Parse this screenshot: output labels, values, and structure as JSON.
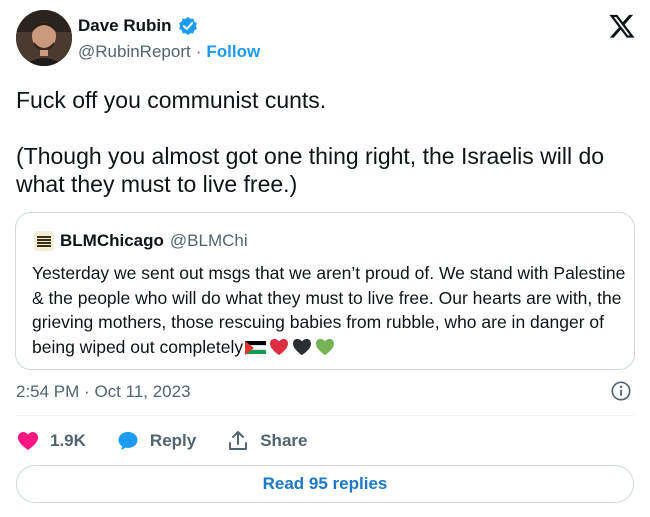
{
  "author": {
    "name": "Dave Rubin",
    "handle": "@RubinReport",
    "separator": "·",
    "follow_label": "Follow"
  },
  "tweet": {
    "line1": "Fuck off you communist cunts.",
    "line2": " (Though you almost got one thing right, the Israelis will do what they must to live free.)"
  },
  "quote": {
    "name": "BLMChicago",
    "handle": "@BLMChi",
    "text": "Yesterday we sent out msgs that we aren’t proud of. We stand with Palestine & the people who will do what they must to live free. Our hearts are with, the grieving mothers, those rescuing babies from rubble, who are in danger of being wiped out completely",
    "emojis": [
      "palestine-flag",
      "red-heart",
      "black-heart",
      "green-heart"
    ]
  },
  "meta": {
    "time": "2:54 PM",
    "separator": "·",
    "date": "Oct 11, 2023"
  },
  "actions": {
    "likes": "1.9K",
    "reply_label": "Reply",
    "share_label": "Share"
  },
  "read_replies_label": "Read 95 replies",
  "colors": {
    "accent": "#1d9bf0",
    "like": "#f91880",
    "muted": "#536471",
    "border": "#cfd9de"
  }
}
